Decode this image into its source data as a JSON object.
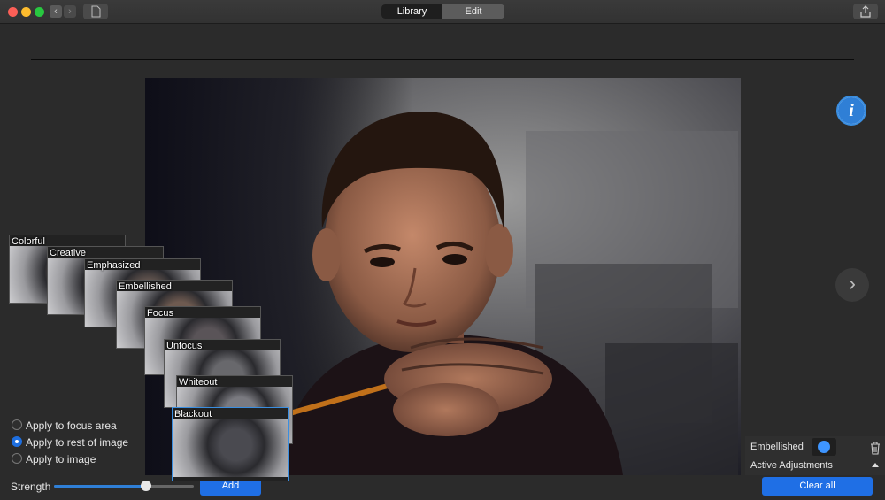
{
  "window": {
    "tabs": [
      {
        "label": "Library",
        "selected": true
      },
      {
        "label": "Edit",
        "selected": false
      }
    ],
    "traffic_colors": [
      "#fc5f57",
      "#fdbc2e",
      "#28c840"
    ],
    "nav_back": "‹",
    "nav_forward": "›"
  },
  "viewer": {
    "info_icon": "i",
    "next_icon": "›"
  },
  "presets": [
    {
      "label": "Colorful"
    },
    {
      "label": "Creative"
    },
    {
      "label": "Emphasized"
    },
    {
      "label": "Embellished"
    },
    {
      "label": "Focus"
    },
    {
      "label": "Unfocus"
    },
    {
      "label": "Whiteout"
    },
    {
      "label": "Blackout",
      "selected": true
    }
  ],
  "apply_options": [
    {
      "label": "Apply to focus area",
      "selected": false
    },
    {
      "label": "Apply to rest of image",
      "selected": true
    },
    {
      "label": "Apply to image",
      "selected": false
    }
  ],
  "strength": {
    "label": "Strength",
    "value": 0.66
  },
  "add_button": "Add",
  "adjustments": {
    "current_label": "Embellished",
    "swatch_color": "#3e95ff",
    "section_label": "Active Adjustments",
    "clear_button": "Clear all"
  },
  "accent_color": "#1f6fe5"
}
